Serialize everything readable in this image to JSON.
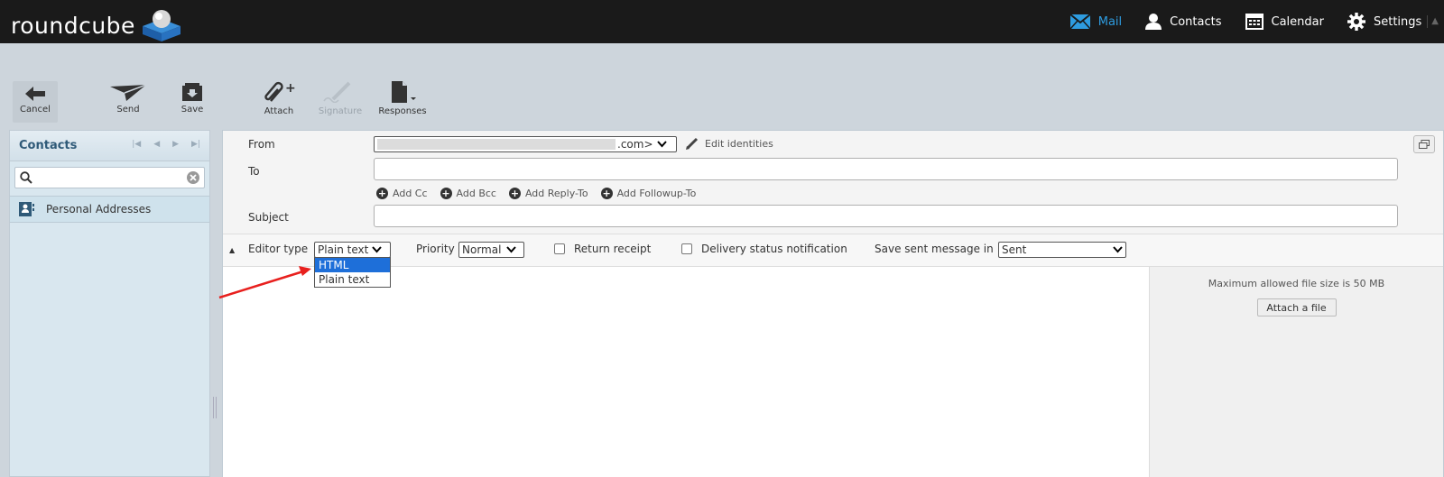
{
  "app": {
    "logo_text": "roundcube"
  },
  "nav": {
    "mail": "Mail",
    "contacts": "Contacts",
    "calendar": "Calendar",
    "settings": "Settings"
  },
  "toolbar": {
    "cancel": "Cancel",
    "send": "Send",
    "save": "Save",
    "attach": "Attach",
    "signature": "Signature",
    "responses": "Responses"
  },
  "sidebar": {
    "title": "Contacts",
    "search_placeholder": "",
    "items": [
      {
        "label": "Personal Addresses"
      }
    ]
  },
  "compose": {
    "from_label": "From",
    "from_value": ".com>",
    "edit_identities": "Edit identities",
    "to_label": "To",
    "add_cc": "Add Cc",
    "add_bcc": "Add Bcc",
    "add_reply_to": "Add Reply-To",
    "add_followup_to": "Add Followup-To",
    "subject_label": "Subject"
  },
  "options": {
    "editor_type_label": "Editor type",
    "editor_type_value": "Plain text",
    "editor_type_options": [
      "HTML",
      "Plain text"
    ],
    "priority_label": "Priority",
    "priority_value": "Normal",
    "return_receipt": "Return receipt",
    "dsn": "Delivery status notification",
    "save_sent_label": "Save sent message in",
    "save_sent_value": "Sent"
  },
  "attachments": {
    "max_size_note": "Maximum allowed file size is 50 MB",
    "attach_button": "Attach a file"
  },
  "colors": {
    "accent": "#2e9ce0",
    "highlight": "#1e6fd9",
    "arrow": "#e8201e"
  }
}
